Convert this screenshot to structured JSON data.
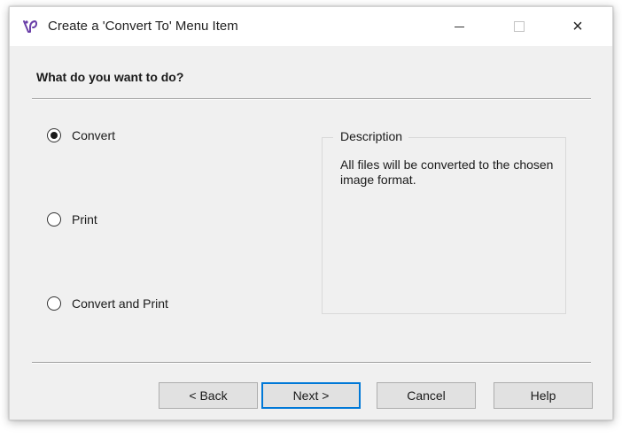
{
  "window": {
    "title": "Create a 'Convert To' Menu Item",
    "icon": "app-logo-icon",
    "controls": {
      "minimize": "minimize-icon",
      "maximize": "maximize-icon",
      "close": "×"
    }
  },
  "page": {
    "heading": "What do you want to do?"
  },
  "options": [
    {
      "label": "Convert",
      "selected": true
    },
    {
      "label": "Print",
      "selected": false
    },
    {
      "label": "Convert and Print",
      "selected": false
    }
  ],
  "description": {
    "legend": "Description",
    "text": "All files will be converted to the chosen image format."
  },
  "buttons": {
    "back": "< Back",
    "next": "Next >",
    "cancel": "Cancel",
    "help": "Help"
  },
  "colors": {
    "dialog_bg": "#f0f0f0",
    "focus_border": "#0078d7",
    "icon_purple": "#6a3fa8"
  }
}
